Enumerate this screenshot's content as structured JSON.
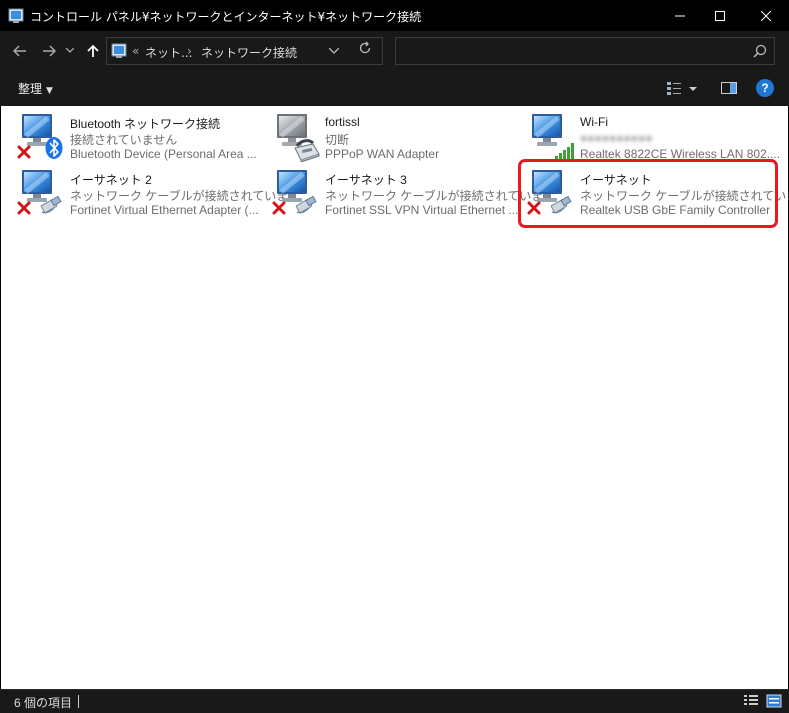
{
  "window": {
    "title": "コントロール パネル¥ネットワークとインターネット¥ネットワーク接続"
  },
  "address": {
    "overflow": "«",
    "crumb1": "ネット...",
    "crumb2": "ネットワーク接続"
  },
  "toolbar": {
    "organize_label": "整理",
    "help_label": "?"
  },
  "connections": [
    {
      "name": "Bluetooth ネットワーク接続",
      "status": "接続されていません",
      "device": "Bluetooth Device (Personal Area ...",
      "icon": "bluetooth-adapter-icon"
    },
    {
      "name": "fortissl",
      "status": "切断",
      "device": "PPPoP WAN Adapter",
      "icon": "dialup-modem-icon"
    },
    {
      "name": "Wi-Fi",
      "status": "●●●●●●●●●●",
      "device": "Realtek 8822CE Wireless LAN 802....",
      "icon": "wifi-adapter-icon"
    },
    {
      "name": "イーサネット 2",
      "status": "ネットワーク ケーブルが接続されていま...",
      "device": "Fortinet Virtual Ethernet Adapter (...",
      "icon": "ethernet-adapter-icon"
    },
    {
      "name": "イーサネット 3",
      "status": "ネットワーク ケーブルが接続されていま...",
      "device": "Fortinet SSL VPN Virtual Ethernet ...",
      "icon": "ethernet-adapter-icon"
    },
    {
      "name": "イーサネット",
      "status": "ネットワーク ケーブルが接続されていま...",
      "device": "Realtek USB GbE Family Controller",
      "icon": "ethernet-adapter-icon"
    }
  ],
  "statusbar": {
    "item_count": "6 個の項目"
  },
  "colors": {
    "highlight": "#e8191f",
    "disconnected_x": "#d4141b",
    "bluetooth": "#1b74e4",
    "wifi_signal": "#3aa33a"
  }
}
